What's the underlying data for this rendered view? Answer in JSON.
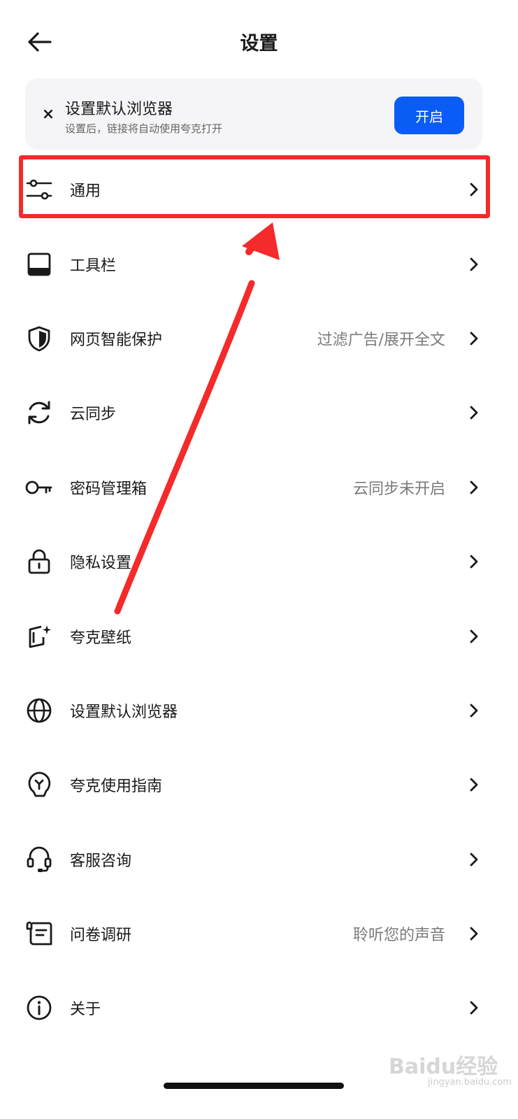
{
  "header": {
    "title": "设置",
    "back_icon": "arrow-left-icon"
  },
  "banner": {
    "close_icon": "close-icon",
    "close_glyph": "×",
    "title": "设置默认浏览器",
    "subtitle": "设置后，链接将自动使用夸克打开",
    "button_label": "开启",
    "button_color": "#0a5cf5"
  },
  "menu": {
    "items": [
      {
        "icon": "sliders-icon",
        "label": "通用",
        "value": ""
      },
      {
        "icon": "toolbar-icon",
        "label": "工具栏",
        "value": ""
      },
      {
        "icon": "shield-icon",
        "label": "网页智能保护",
        "value": "过滤广告/展开全文"
      },
      {
        "icon": "sync-icon",
        "label": "云同步",
        "value": ""
      },
      {
        "icon": "key-icon",
        "label": "密码管理箱",
        "value": "云同步未开启"
      },
      {
        "icon": "lock-icon",
        "label": "隐私设置",
        "value": ""
      },
      {
        "icon": "wallpaper-icon",
        "label": "夸克壁纸",
        "value": ""
      },
      {
        "icon": "globe-icon",
        "label": "设置默认浏览器",
        "value": ""
      },
      {
        "icon": "guide-bulb-icon",
        "label": "夸克使用指南",
        "value": ""
      },
      {
        "icon": "headset-icon",
        "label": "客服咨询",
        "value": ""
      },
      {
        "icon": "survey-icon",
        "label": "问卷调研",
        "value": "聆听您的声音"
      },
      {
        "icon": "info-icon",
        "label": "关于",
        "value": ""
      }
    ],
    "chevron_icon": "chevron-right-icon"
  },
  "annotation": {
    "highlight_color": "#f52a2a",
    "arrow_color": "#f52a2a",
    "highlighted_item": "通用"
  },
  "watermark": {
    "text": "Baidu经验",
    "subtext": "jingyan.baidu.com"
  }
}
